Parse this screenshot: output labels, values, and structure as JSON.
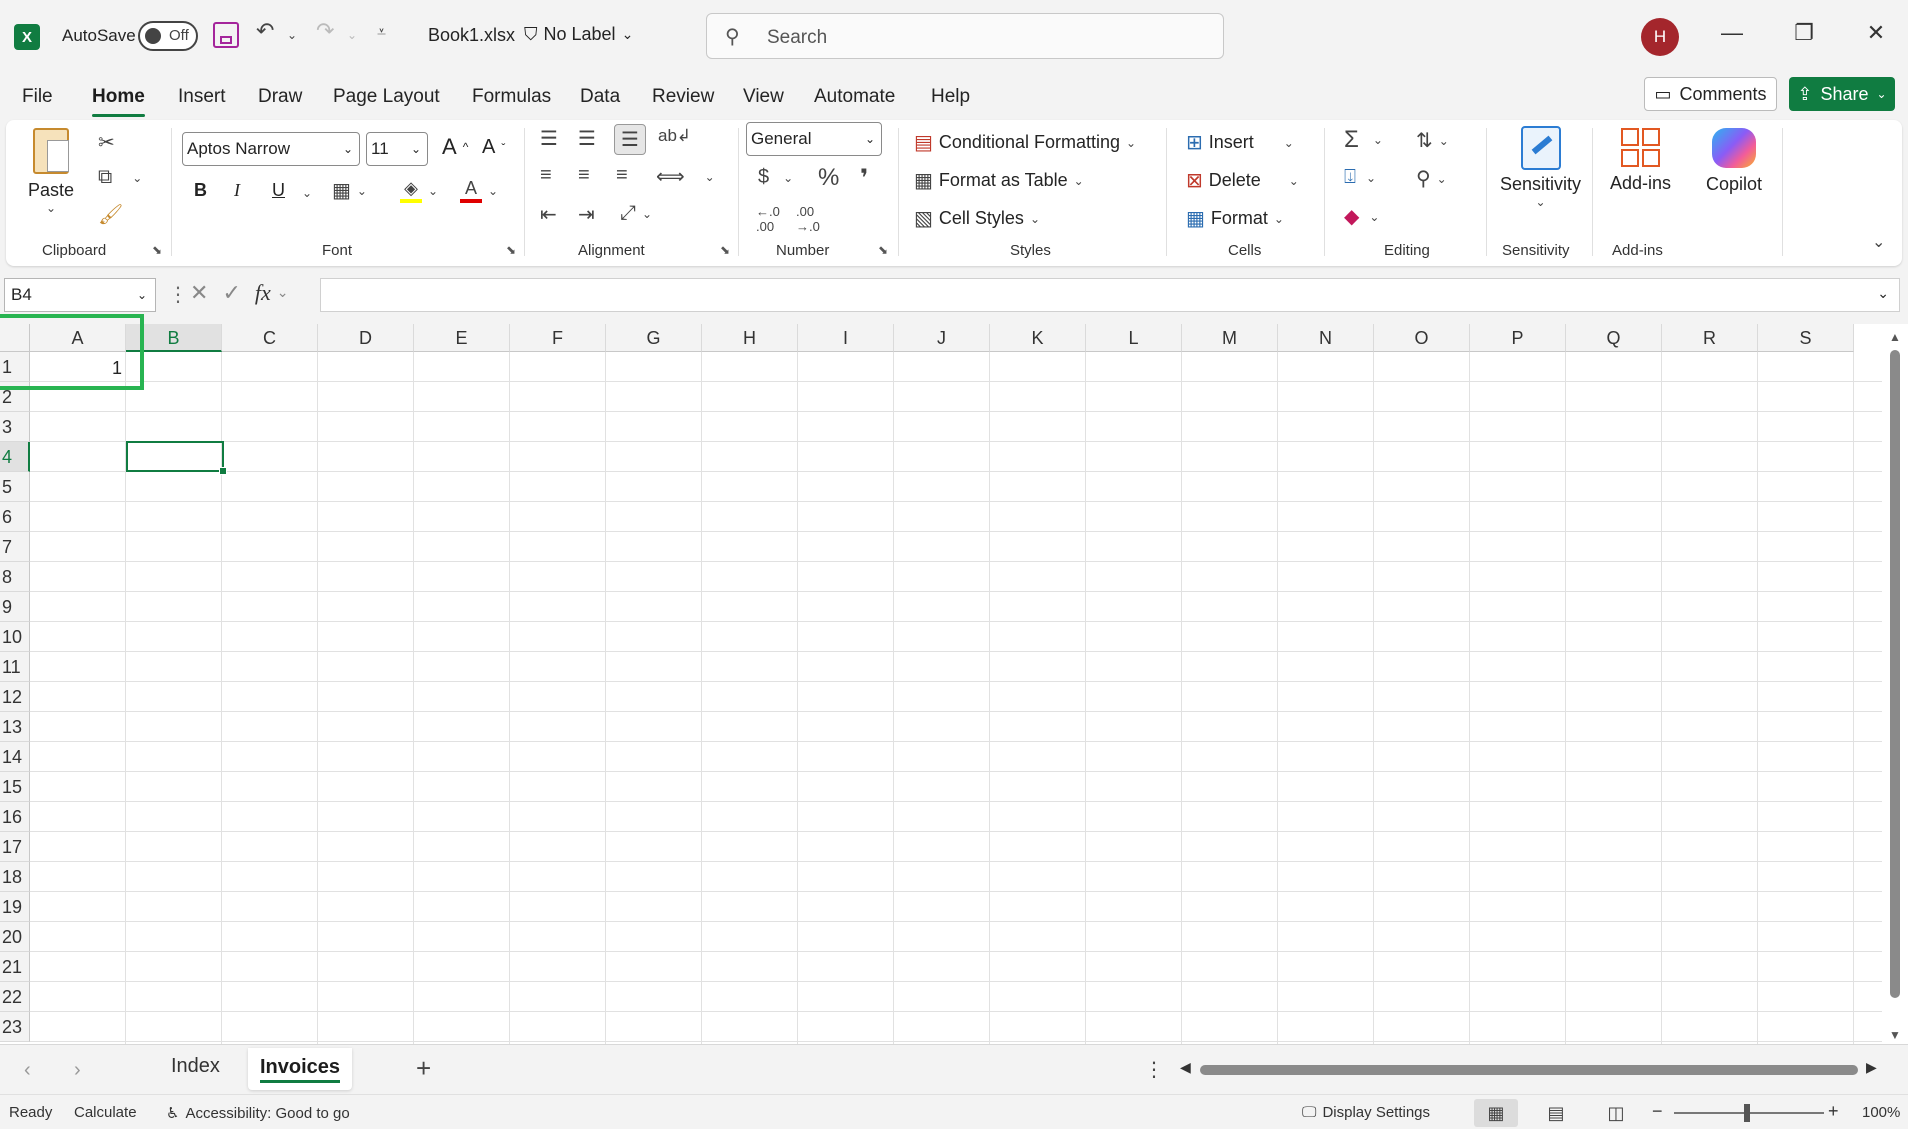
{
  "titlebar": {
    "app_icon_letter": "X",
    "autosave_label": "AutoSave",
    "autosave_state": "Off",
    "filename": "Book1.xlsx",
    "sensitivity_label": "No Label",
    "search_placeholder": "Search",
    "avatar_initial": "H"
  },
  "menu": {
    "tabs": [
      "File",
      "Home",
      "Insert",
      "Draw",
      "Page Layout",
      "Formulas",
      "Data",
      "Review",
      "View",
      "Automate",
      "Help"
    ],
    "active_tab": "Home",
    "comments_label": "Comments",
    "share_label": "Share"
  },
  "ribbon": {
    "clipboard": {
      "paste_label": "Paste",
      "group_label": "Clipboard"
    },
    "font": {
      "font_name": "Aptos Narrow",
      "font_size": "11",
      "group_label": "Font",
      "bold": "B",
      "italic": "I",
      "underline": "U"
    },
    "alignment": {
      "group_label": "Alignment"
    },
    "number": {
      "format": "General",
      "group_label": "Number"
    },
    "styles": {
      "conditional_formatting": "Conditional Formatting",
      "format_as_table": "Format as Table",
      "cell_styles": "Cell Styles",
      "group_label": "Styles"
    },
    "cells": {
      "insert": "Insert",
      "delete": "Delete",
      "format": "Format",
      "group_label": "Cells"
    },
    "editing": {
      "group_label": "Editing"
    },
    "sensitivity": {
      "button_label": "Sensitivity",
      "group_label": "Sensitivity"
    },
    "addins": {
      "button_label": "Add-ins",
      "group_label": "Add-ins"
    },
    "copilot": {
      "button_label": "Copilot"
    }
  },
  "formula_bar": {
    "name_box": "B4",
    "fx_label": "fx",
    "formula": ""
  },
  "grid": {
    "columns": [
      "A",
      "B",
      "C",
      "D",
      "E",
      "F",
      "G",
      "H",
      "I",
      "J",
      "K",
      "L",
      "M",
      "N",
      "O",
      "P",
      "Q",
      "R",
      "S"
    ],
    "rows": [
      "1",
      "2",
      "3",
      "4",
      "5",
      "6",
      "7",
      "8",
      "9",
      "10",
      "11",
      "12",
      "13",
      "14",
      "15",
      "16",
      "17",
      "18",
      "19",
      "20",
      "21",
      "22",
      "23"
    ],
    "selected_column": "B",
    "selected_row": "4",
    "cell_A1": "1"
  },
  "sheets": {
    "tabs": [
      "Index",
      "Invoices"
    ],
    "active": "Invoices"
  },
  "status": {
    "ready": "Ready",
    "calculate": "Calculate",
    "accessibility": "Accessibility: Good to go",
    "display_settings": "Display Settings",
    "zoom": "100%"
  },
  "colors": {
    "accent_green": "#107c41",
    "highlight_green": "#28b451",
    "avatar_red": "#a4262c",
    "save_purple": "#a4259b"
  }
}
